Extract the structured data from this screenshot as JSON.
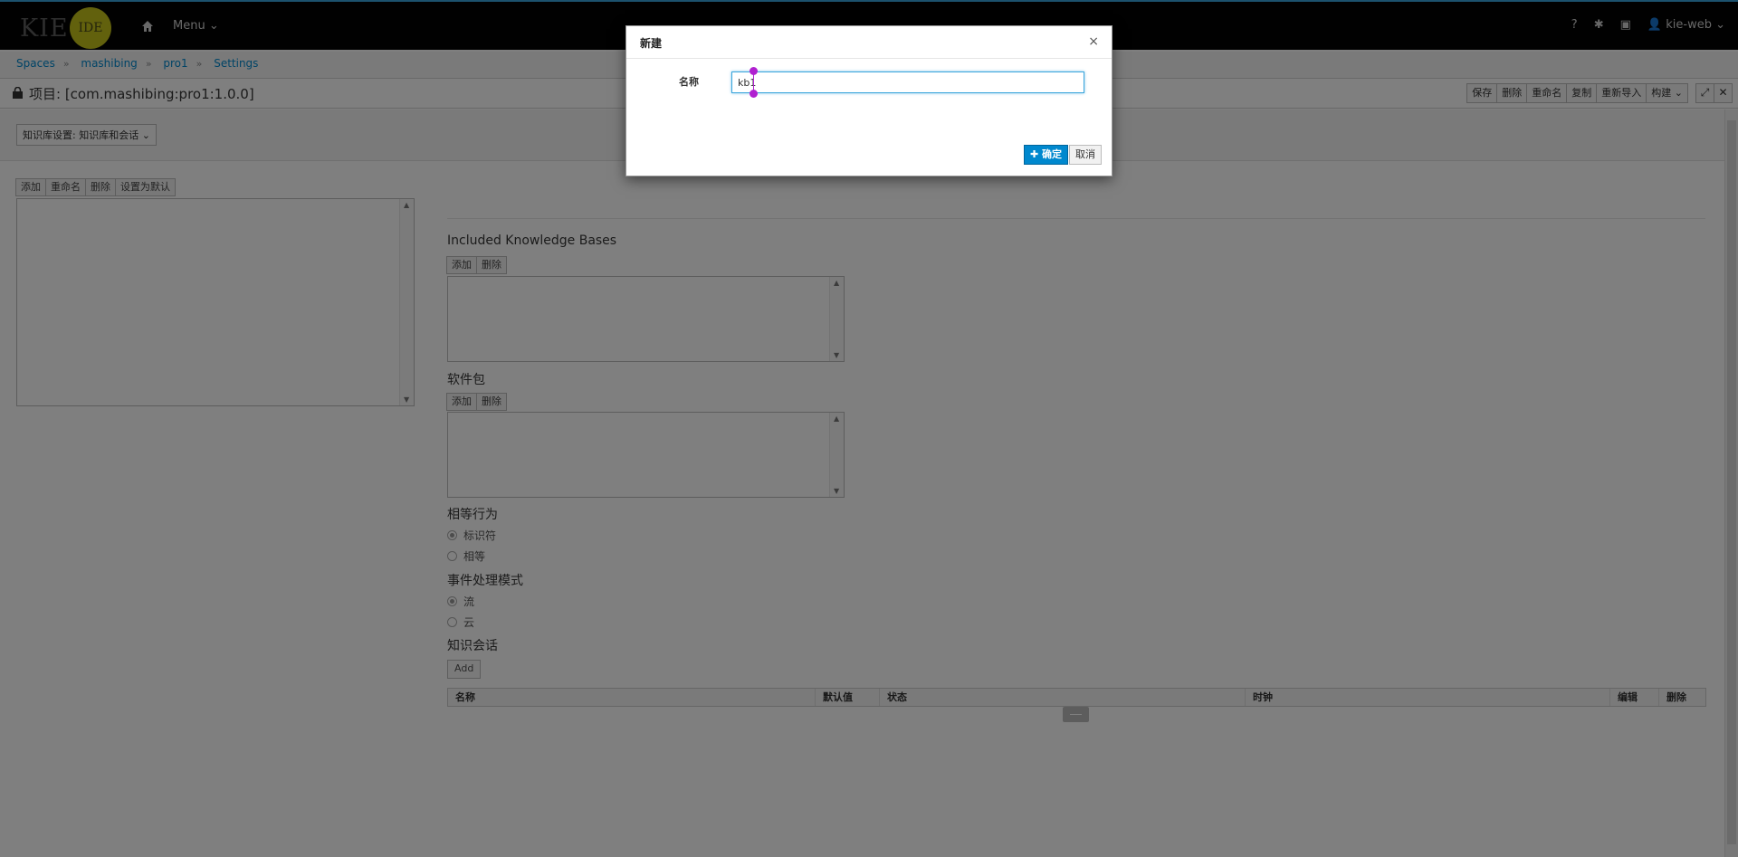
{
  "navbar": {
    "logo_kie": "KIE",
    "logo_ide": "IDE",
    "menu_label": "Menu",
    "help_label": "?",
    "user_label": "kie-web"
  },
  "breadcrumb": [
    "Spaces",
    "mashibing",
    "pro1",
    "Settings"
  ],
  "titlebar": {
    "title": "项目: [com.mashibing:pro1:1.0.0]",
    "toolbar": [
      "保存",
      "删除",
      "重命名",
      "复制",
      "重新导入",
      "构建"
    ]
  },
  "settings": {
    "kb_dropdown": "知识库设置: 知识库和会话"
  },
  "kb_list_buttons": [
    "添加",
    "重命名",
    "删除",
    "设置为默认"
  ],
  "included_kb": {
    "label": "Included Knowledge Bases",
    "buttons": [
      "添加",
      "删除"
    ]
  },
  "packages": {
    "label": "软件包",
    "buttons": [
      "添加",
      "删除"
    ]
  },
  "equality": {
    "label": "相等行为",
    "options": [
      "标识符",
      "相等"
    ],
    "selected": "标识符"
  },
  "event_mode": {
    "label": "事件处理模式",
    "options": [
      "流",
      "云"
    ],
    "selected": "流"
  },
  "sessions": {
    "label": "知识会话",
    "add_label": "Add",
    "columns": [
      "名称",
      "默认值",
      "状态",
      "时钟",
      "编辑",
      "删除"
    ]
  },
  "modal": {
    "title": "新建",
    "close": "×",
    "field_label": "名称",
    "field_value": "kb1",
    "ok_label": "✚ 确定",
    "cancel_label": "取消"
  },
  "colors": {
    "accent": "#0088ce",
    "navbar": "#030303",
    "cursor_handle": "#b020d0"
  }
}
